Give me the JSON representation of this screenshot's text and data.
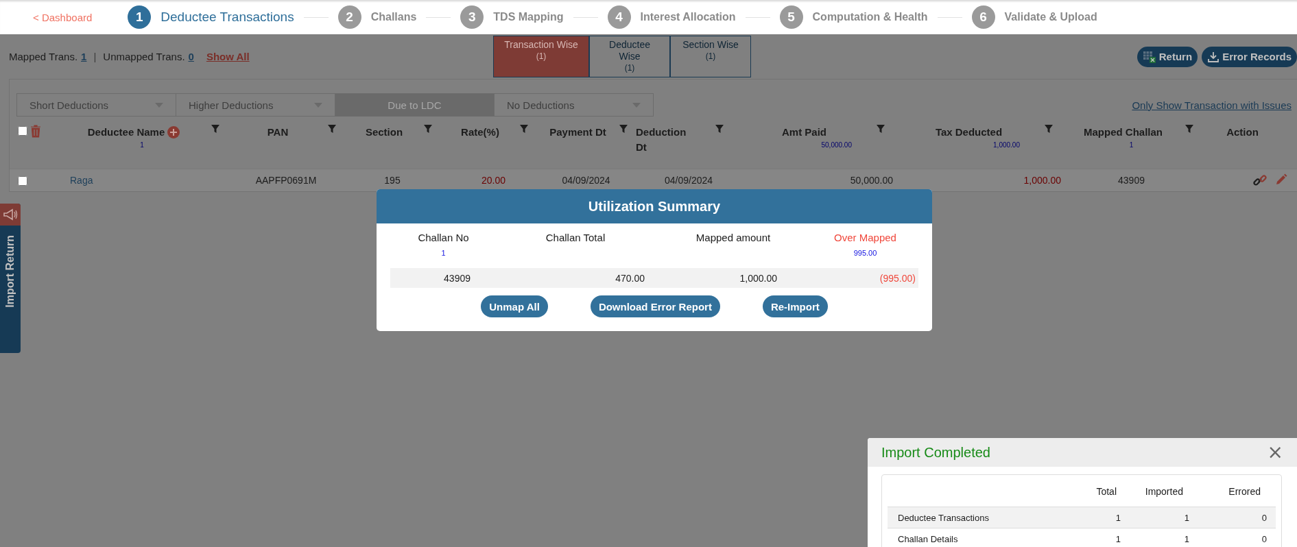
{
  "nav": {
    "back_link": "< Dashboard",
    "steps": [
      {
        "number": "1",
        "label": "Deductee Transactions",
        "selected": true
      },
      {
        "number": "2",
        "label": "Challans",
        "selected": false
      },
      {
        "number": "3",
        "label": "TDS Mapping",
        "selected": false
      },
      {
        "number": "4",
        "label": "Interest Allocation",
        "selected": false
      },
      {
        "number": "5",
        "label": "Computation & Health",
        "selected": false
      },
      {
        "number": "6",
        "label": "Validate & Upload",
        "selected": false
      }
    ]
  },
  "summary": {
    "mapped_label": "Mapped Trans.",
    "mapped_count": "1",
    "separator": "|",
    "unmapped_label": "Unmapped Trans.",
    "unmapped_count": "0",
    "show_all": "Show All"
  },
  "view_tabs": [
    {
      "label": "Transaction Wise",
      "count": "(1)",
      "selected": true
    },
    {
      "label": "Deductee Wise",
      "count": "(1)",
      "selected": false
    },
    {
      "label": "Section Wise",
      "count": "(1)",
      "selected": false
    }
  ],
  "actions": [
    {
      "label": "Return",
      "kind": "excel"
    },
    {
      "label": "Error Records",
      "kind": "download"
    }
  ],
  "filters": [
    {
      "label": "Short Deductions",
      "disabled": false
    },
    {
      "label": "Higher Deductions",
      "disabled": false
    },
    {
      "label": "Due to LDC",
      "disabled": true
    },
    {
      "label": "No Deductions",
      "disabled": false
    }
  ],
  "issues_link": "Only Show Transaction with Issues",
  "table": {
    "select_all_checked": false,
    "columns": [
      {
        "label": "Deductee Name",
        "subtotal": "1"
      },
      {
        "label": "PAN"
      },
      {
        "label": "Section"
      },
      {
        "label": "Rate(%)"
      },
      {
        "label": "Payment Dt"
      },
      {
        "label": "Deduction Dt"
      },
      {
        "label": "Amt Paid",
        "subtotal": "50,000.00"
      },
      {
        "label": "Tax Deducted",
        "subtotal": "1,000.00"
      },
      {
        "label": "Mapped Challan",
        "subtotal": "1"
      },
      {
        "label": "Action"
      }
    ],
    "rows": [
      {
        "checked": false,
        "cells": [
          {
            "text": "Raga",
            "kind": "link"
          },
          {
            "text": "AAPFP0691M",
            "kind": "plain"
          },
          {
            "text": "195",
            "kind": "plain"
          },
          {
            "text": "20.00",
            "kind": "warn"
          },
          {
            "text": "04/09/2024",
            "kind": "plain"
          },
          {
            "text": "04/09/2024",
            "kind": "plain"
          },
          {
            "text": "50,000.00",
            "kind": "plain"
          },
          {
            "text": "1,000.00",
            "kind": "warn"
          },
          {
            "text": "43909",
            "kind": "plain"
          }
        ]
      }
    ]
  },
  "side_tab": {
    "label": "Import Return"
  },
  "utilization": {
    "title": "Utilization Summary",
    "columns": [
      {
        "label": "Challan No",
        "subtotal": "1",
        "kind": "plain"
      },
      {
        "label": "Challan Total",
        "kind": "plain"
      },
      {
        "label": "Mapped amount",
        "kind": "plain"
      },
      {
        "label": "Over Mapped",
        "subtotal": "995.00",
        "kind": "warn"
      }
    ],
    "rows": [
      {
        "cells": [
          {
            "text": "43909",
            "kind": "plain"
          },
          {
            "text": "470.00",
            "kind": "plain"
          },
          {
            "text": "1,000.00",
            "kind": "plain"
          },
          {
            "text": "(995.00)",
            "kind": "warn"
          }
        ]
      }
    ],
    "buttons": [
      "Unmap All",
      "Download Error Report",
      "Re-Import"
    ]
  },
  "import_status": {
    "title": "Import Completed",
    "close": "×",
    "columns": [
      "Total",
      "Imported",
      "Errored"
    ],
    "rows": [
      {
        "label": "Deductee Transactions",
        "values": [
          "1",
          "1",
          "0"
        ]
      },
      {
        "label": "Challan Details",
        "values": [
          "1",
          "1",
          "0"
        ]
      }
    ]
  }
}
